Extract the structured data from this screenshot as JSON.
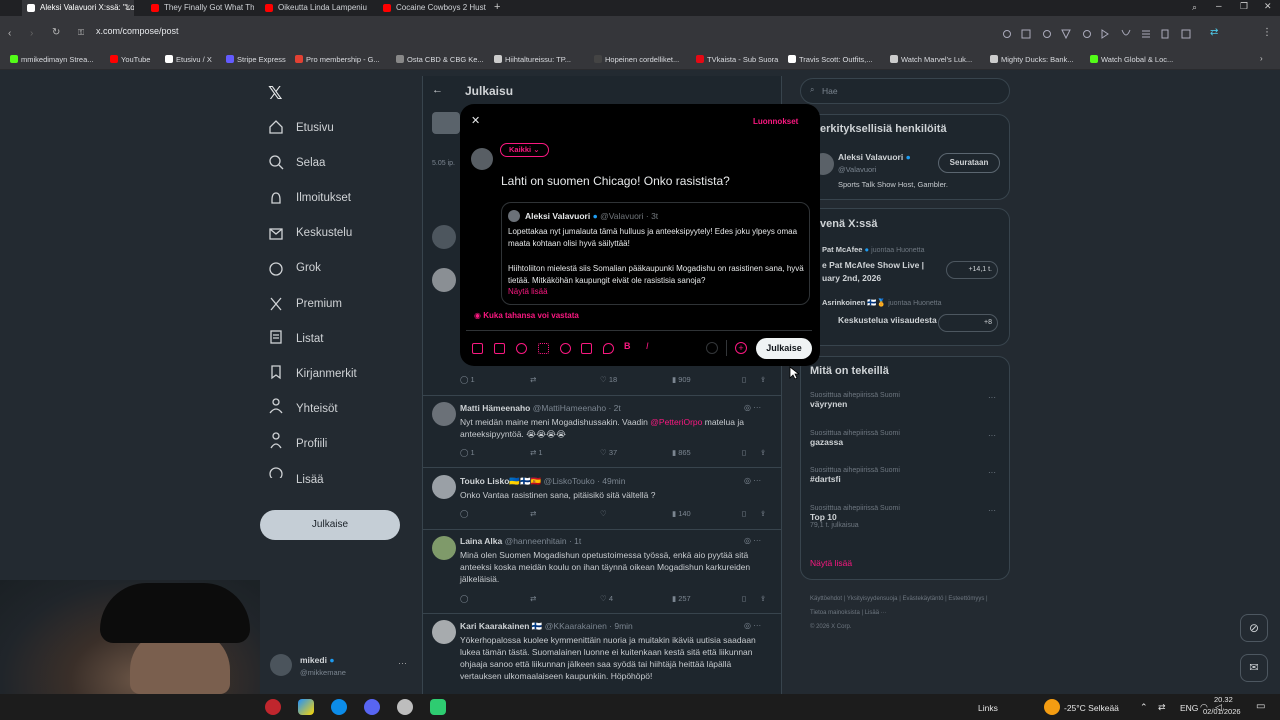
{
  "browser": {
    "tabs": [
      {
        "label": "Aleksi Valavuori X:ssä: \"Lo",
        "active": true,
        "color": "#ffffff"
      },
      {
        "label": "They Finally Got What The",
        "active": false,
        "color": "#ff0000"
      },
      {
        "label": "Oikeutta Linda Lampeniu",
        "active": false,
        "color": "#ff0000"
      },
      {
        "label": "Cocaine Cowboys 2 Hust",
        "active": false,
        "color": "#ff0000"
      }
    ],
    "new_tab": "+",
    "url": "x.com/compose/post",
    "bookmarks": [
      {
        "label": "mmikedimayn Strea...",
        "color": "#53fc18"
      },
      {
        "label": "YouTube",
        "color": "#ff0000"
      },
      {
        "label": "Etusivu / X",
        "color": "#ffffff"
      },
      {
        "label": "Stripe Express",
        "color": "#635bff"
      },
      {
        "label": "Pro membership - G...",
        "color": "#e34133"
      },
      {
        "label": "Osta CBD & CBG Ke...",
        "color": "#888888"
      },
      {
        "label": "Hiihtaltureissu: TP...",
        "color": "#cccccc"
      },
      {
        "label": "Hopeinen cordelliket...",
        "color": "#444444"
      },
      {
        "label": "TVkaista - Sub Suora",
        "color": "#e50914"
      },
      {
        "label": "Travis Scott: Outfits,...",
        "color": "#ffffff"
      },
      {
        "label": "Watch Marvel's Luk...",
        "color": "#cccccc"
      },
      {
        "label": "Mighty Ducks: Bank...",
        "color": "#cccccc"
      },
      {
        "label": "Watch Global & Loc...",
        "color": "#53fc18"
      }
    ]
  },
  "sidebar": {
    "items": [
      {
        "label": "Etusivu",
        "icon": "home-icon"
      },
      {
        "label": "Selaa",
        "icon": "search-icon"
      },
      {
        "label": "Ilmoitukset",
        "icon": "bell-icon"
      },
      {
        "label": "Keskustelu",
        "icon": "mail-icon"
      },
      {
        "label": "Grok",
        "icon": "grok-icon"
      },
      {
        "label": "Premium",
        "icon": "x-icon"
      },
      {
        "label": "Listat",
        "icon": "list-icon"
      },
      {
        "label": "Kirjanmerkit",
        "icon": "bookmark-icon"
      },
      {
        "label": "Yhteisöt",
        "icon": "people-icon"
      },
      {
        "label": "Profiili",
        "icon": "person-icon"
      },
      {
        "label": "Lisää",
        "icon": "more-icon"
      }
    ],
    "post_button": "Julkaise",
    "account_name": "mikedi",
    "account_handle": "@mikkemane"
  },
  "feed": {
    "header": "Julkaisu",
    "time": "5.05 ip.",
    "replies": [
      {
        "name": "Matti Hämeenaho",
        "handle": "@MattiHameenaho · 2t",
        "text": "Nyt meidän maine meni Mogadishussakin. Vaadin",
        "mention": "@PetteriOrpo",
        "text2": "matelua ja anteeksipyyntöä. 😭😭😭😭",
        "reply": "1",
        "retweet": "1",
        "like": "37",
        "views": "865"
      },
      {
        "name": "Touko Lisko🇺🇦🇫🇮🇪🇸",
        "handle": "@LiskoTouko · 49min",
        "text": "Onko Vantaa rasistinen sana, pitäisikö sitä vältellä ?",
        "reply": "",
        "retweet": "",
        "like": "",
        "views": "140"
      },
      {
        "name": "Laina Alka",
        "handle": "@hanneenhitain · 1t",
        "text": "Minä olen Suomen Mogadishun opetustoimessa työssä, enkä aio pyytää sitä anteeksi koska meidän koulu on ihan täynnä oikean Mogadishun karkureiden jälkeläisiä.",
        "reply": "",
        "retweet": "",
        "like": "4",
        "views": "257"
      },
      {
        "name": "Kari Kaarakainen 🇫🇮",
        "handle": "@KKaarakainen · 9min",
        "text": "Yökerhopalossa kuolee kymmenittäin nuoria ja muitakin ikäviä uutisia saadaan lukea tämän tästä. Suomalainen luonne ei kuitenkaan kestä sitä että liikunnan ohjaaja sanoo että liikunnan jälkeen saa syödä tai hiihtäjä heittää läpällä vertauksen ulkomaalaiseen kaupunkiin. Höpöhöpö!"
      }
    ],
    "prev_actions": {
      "reply": "1",
      "like": "18",
      "views": "909"
    }
  },
  "modal": {
    "drafts": "Luonnokset",
    "audience": "Kaikki",
    "compose_text": "Lahti on suomen Chicago! Onko rasistista?",
    "quote": {
      "name": "Aleksi Valavuori",
      "handle": "@Valavuori · 3t",
      "text1": "Lopettakaa nyt jumalauta tämä hulluus ja anteeksipyytely! Edes joku ylpeys omaa maata kohtaan olisi hyvä säilyttää!",
      "text2": "Hiihtoliiton mielestä siis Somalian pääkaupunki Mogadishu on rasistinen sana, hyvä tietää. Mitkäköhän kaupungit eivät ole rasistisia sanoja?",
      "show_more": "Näytä lisää"
    },
    "reply_setting": "Kuka tahansa voi vastata",
    "publish": "Julkaise"
  },
  "right": {
    "search_placeholder": "Hae",
    "who_to_follow_title": "erkityksellisiä henkilöitä",
    "follow_name": "Aleksi Valavuori",
    "follow_handle": "@Valavuori",
    "follow_bio": "Sports Talk Show Host, Gambler.",
    "follow_button": "Seurataan",
    "live_title": "venä X:ssä",
    "live1_host": "Pat McAfee",
    "live1_meta": "juontaa Huonetta",
    "live1_title": "e Pat McAfee Show Live |",
    "live1_title2": "uary 2nd, 2026",
    "live1_count": "+14,1 t.",
    "live2_host": "Asrinkoinen 🇫🇮🏅",
    "live2_meta": "juontaa Huonetta",
    "live2_title": "Keskustelua viisaudesta",
    "live2_count": "+8",
    "trends_title": "Mitä on tekeillä",
    "trends": [
      {
        "meta": "Suositttua aihepiirissä Suomi",
        "name": "väyrynen",
        "count": ""
      },
      {
        "meta": "Suositttua aihepiirissä Suomi",
        "name": "gazassa",
        "count": ""
      },
      {
        "meta": "Suositttua aihepiirissä Suomi",
        "name": "#dartsfi",
        "count": ""
      },
      {
        "meta": "Suositttua aihepiirissä Suomi",
        "name": "Top 10",
        "count": "79,1 t. julkaisua"
      }
    ],
    "show_more": "Näytä lisää",
    "footer": [
      "Käyttöehdot",
      "Yksityisyydensuoja",
      "Evästekäytäntö",
      "Esteettömyys",
      "Tietoa mainoksista",
      "Lisää ···",
      "© 2026 X Corp."
    ]
  },
  "taskbar": {
    "links": "Links",
    "weather": "-25°C Selkeää",
    "lang": "ENG",
    "time": "20.32",
    "date": "02/01/2026"
  },
  "colors": {
    "accent": "#f91880",
    "bg": "#232a31"
  }
}
